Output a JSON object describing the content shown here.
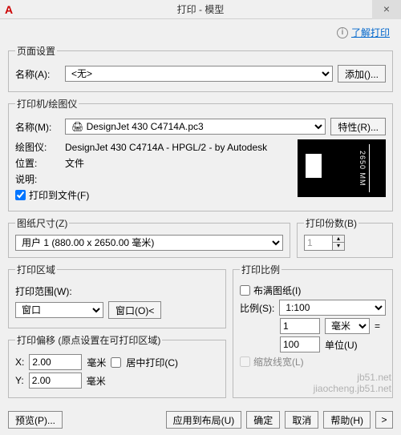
{
  "title_bar": {
    "app_icon": "A",
    "title": "打印 - 模型",
    "close": "×"
  },
  "info": {
    "icon": "i",
    "link_text": "了解打印"
  },
  "page_setup": {
    "legend": "页面设置",
    "name_label": "名称(A):",
    "name_value": "<无>",
    "add_btn": "添加()..."
  },
  "printer": {
    "legend": "打印机/绘图仪",
    "name_label": "名称(M):",
    "name_value": "DesignJet 430 C4714A.pc3",
    "icon": "🖨",
    "props_btn": "特性(R)...",
    "plotter_label": "绘图仪:",
    "plotter_value": "DesignJet 430 C4714A - HPGL/2 - by Autodesk",
    "location_label": "位置:",
    "location_value": "文件",
    "desc_label": "说明:",
    "plot_to_file_label": "打印到文件(F)",
    "preview_dim": "2650 MM"
  },
  "paper": {
    "legend": "图纸尺寸(Z)",
    "value": "用户 1 (880.00 x 2650.00 毫米)"
  },
  "copies": {
    "legend": "打印份数(B)",
    "value": "1"
  },
  "area": {
    "legend": "打印区域",
    "range_label": "打印范围(W):",
    "range_value": "窗口",
    "window_btn": "窗口(O)<"
  },
  "offset": {
    "legend": "打印偏移 (原点设置在可打印区域)",
    "x_label": "X:",
    "x_value": "2.00",
    "x_unit": "毫米",
    "center_label": "居中打印(C)",
    "y_label": "Y:",
    "y_value": "2.00",
    "y_unit": "毫米"
  },
  "scale": {
    "legend": "打印比例",
    "fit_label": "布满图纸(I)",
    "scale_label": "比例(S):",
    "scale_value": "1:100",
    "num_value": "1",
    "num_unit": "毫米",
    "eq": "=",
    "den_value": "100",
    "den_unit": "单位(U)",
    "lw_label": "缩放线宽(L)"
  },
  "footer": {
    "preview": "预览(P)...",
    "apply": "应用到布局(U)",
    "ok": "确定",
    "cancel": "取消",
    "help": "帮助(H)",
    "expand": ">"
  },
  "watermark": {
    "line1": "jb51.net",
    "line2": "jiaocheng.jb51.net"
  }
}
